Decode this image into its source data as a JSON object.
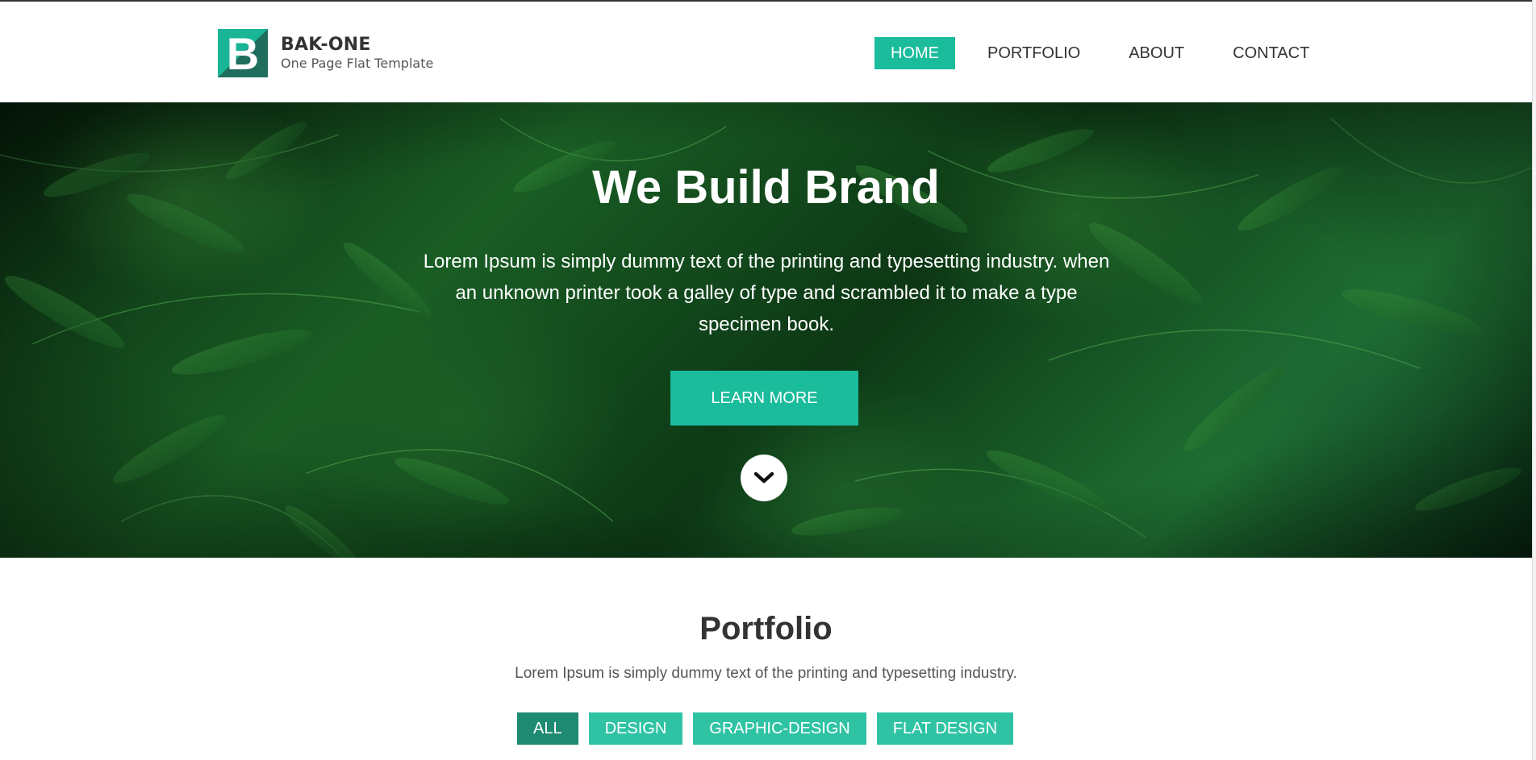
{
  "header": {
    "logo_letter": "B",
    "brand_name": "BAK-ONE",
    "brand_tagline": "One Page Flat Template",
    "nav": [
      {
        "label": "HOME",
        "active": true
      },
      {
        "label": "PORTFOLIO",
        "active": false
      },
      {
        "label": "ABOUT",
        "active": false
      },
      {
        "label": "CONTACT",
        "active": false
      }
    ]
  },
  "hero": {
    "title_light": "We Build ",
    "title_bold": "Brand",
    "text": "Lorem Ipsum is simply dummy text of the printing and typesetting industry. when an unknown printer took a galley of type and scrambled it to make a type specimen book.",
    "button_label": "LEARN MORE",
    "scroll_icon": "chevron-down-icon"
  },
  "portfolio": {
    "title": "Portfolio",
    "subtitle": "Lorem Ipsum is simply dummy text of the printing and typesetting industry.",
    "filters": [
      {
        "label": "ALL",
        "active": true
      },
      {
        "label": "DESIGN",
        "active": false
      },
      {
        "label": "GRAPHIC-DESIGN",
        "active": false
      },
      {
        "label": "FLAT DESIGN",
        "active": false
      }
    ]
  },
  "colors": {
    "accent": "#1abc9c",
    "accent_dark": "#1f8a72",
    "logo_dark": "#1f6e5d",
    "text": "#333333"
  }
}
